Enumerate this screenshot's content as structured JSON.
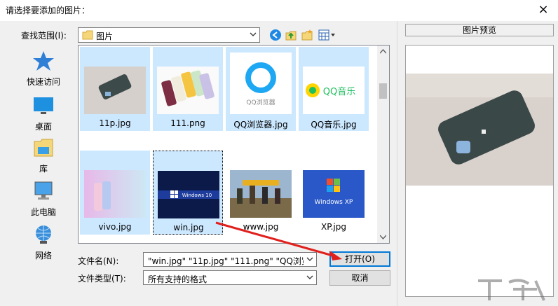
{
  "dialog": {
    "title": "请选择要添加的图片：",
    "close_label": "×"
  },
  "lookin": {
    "label": "查找范围(I):",
    "value": "图片"
  },
  "places": [
    {
      "label": "快速访问",
      "icon": "star-icon"
    },
    {
      "label": "桌面",
      "icon": "desktop-icon"
    },
    {
      "label": "库",
      "icon": "library-icon"
    },
    {
      "label": "此电脑",
      "icon": "computer-icon"
    },
    {
      "label": "网络",
      "icon": "network-icon"
    }
  ],
  "files": [
    {
      "name": "11p.jpg",
      "selected": true
    },
    {
      "name": "111.png",
      "selected": true
    },
    {
      "name": "QQ浏览器.jpg",
      "selected": true,
      "thumb_text": "QQ浏览器"
    },
    {
      "name": "QQ音乐.jpg",
      "selected": true,
      "thumb_text": "QQ音乐"
    },
    {
      "name": "vivo.jpg",
      "selected": true
    },
    {
      "name": "win.jpg",
      "selected": true,
      "focused": true,
      "thumb_text": "Windows 10"
    },
    {
      "name": "www.jpg",
      "selected": false
    },
    {
      "name": "XP.jpg",
      "selected": false,
      "thumb_text": "Windows XP"
    }
  ],
  "filename": {
    "label": "文件名(N):",
    "value": "\"win.jpg\" \"11p.jpg\" \"111.png\" \"QQ浏览"
  },
  "filetype": {
    "label": "文件类型(T):",
    "value": "所有支持的格式"
  },
  "buttons": {
    "open": "打开(O)",
    "cancel": "取消"
  },
  "preview": {
    "header": "图片预览"
  },
  "colors": {
    "selection": "#cce8ff",
    "accent": "#0078d7",
    "arrow": "#e0201c"
  }
}
